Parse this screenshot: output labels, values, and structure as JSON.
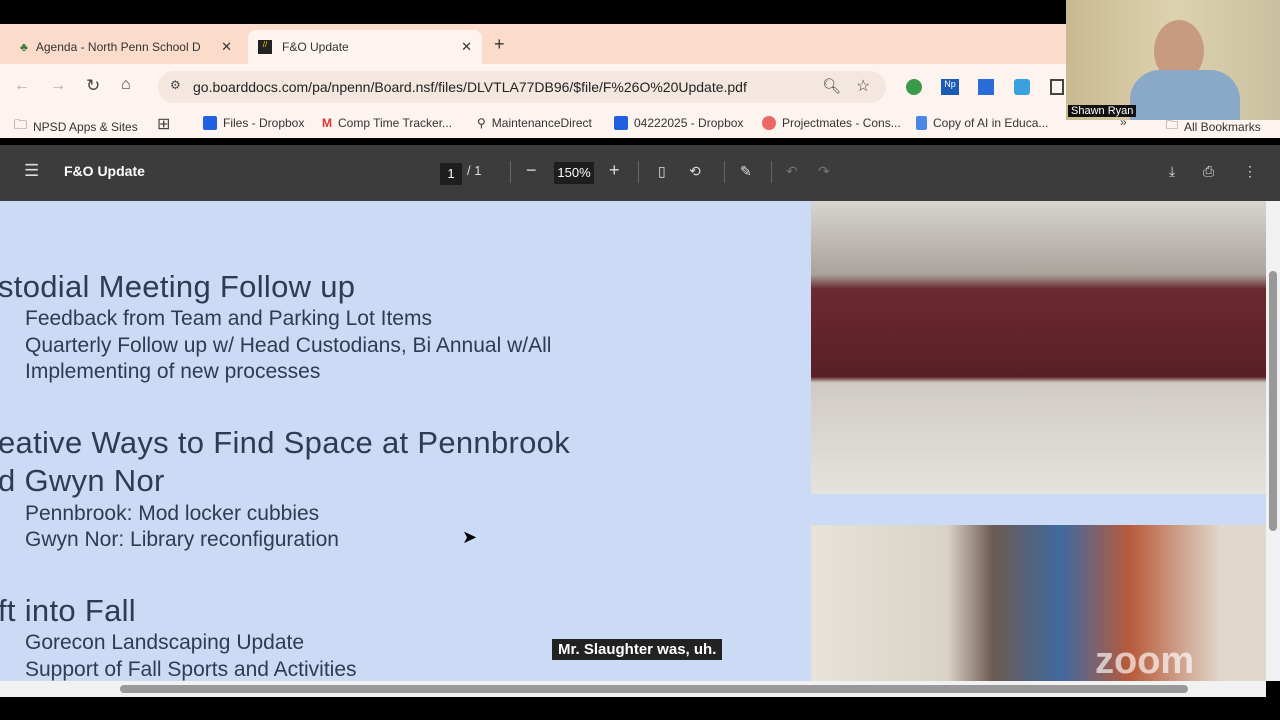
{
  "tabs": [
    {
      "label": "Agenda - North Penn School D"
    },
    {
      "label": "F&O Update"
    }
  ],
  "address": "go.boarddocs.com/pa/npenn/Board.nsf/files/DLVTLA77DB96/$file/F%26O%20Update.pdf",
  "bookmarks": [
    {
      "label": "NPSD Apps & Sites"
    },
    {
      "label": "Files - Dropbox"
    },
    {
      "label": "Comp Time Tracker..."
    },
    {
      "label": "MaintenanceDirect"
    },
    {
      "label": "04222025 - Dropbox"
    },
    {
      "label": "Projectmates - Cons..."
    },
    {
      "label": "Copy of AI in Educa..."
    },
    {
      "label": "All Bookmarks"
    }
  ],
  "viewer": {
    "title": "F&O Update",
    "page": "1",
    "pages": "/  1",
    "zoom": "150%"
  },
  "slide": {
    "h1": "stodial Meeting Follow up",
    "b1": [
      "Feedback from Team and Parking Lot Items",
      "Quarterly Follow up w/ Head Custodians, Bi Annual w/All",
      "Implementing of new processes"
    ],
    "h2a": "eative Ways to Find Space at Pennbrook",
    "h2b": "d Gwyn Nor",
    "b2": [
      "Pennbrook: Mod locker cubbies",
      "Gwyn Nor: Library reconfiguration"
    ],
    "h3": "ft into Fall",
    "b3": [
      "Gorecon Landscaping Update",
      "Support of Fall Sports and Activities"
    ]
  },
  "video": {
    "name": "Shawn Ryan",
    "caption": "Mr. Slaughter was, uh.",
    "watermark": "zoom"
  }
}
